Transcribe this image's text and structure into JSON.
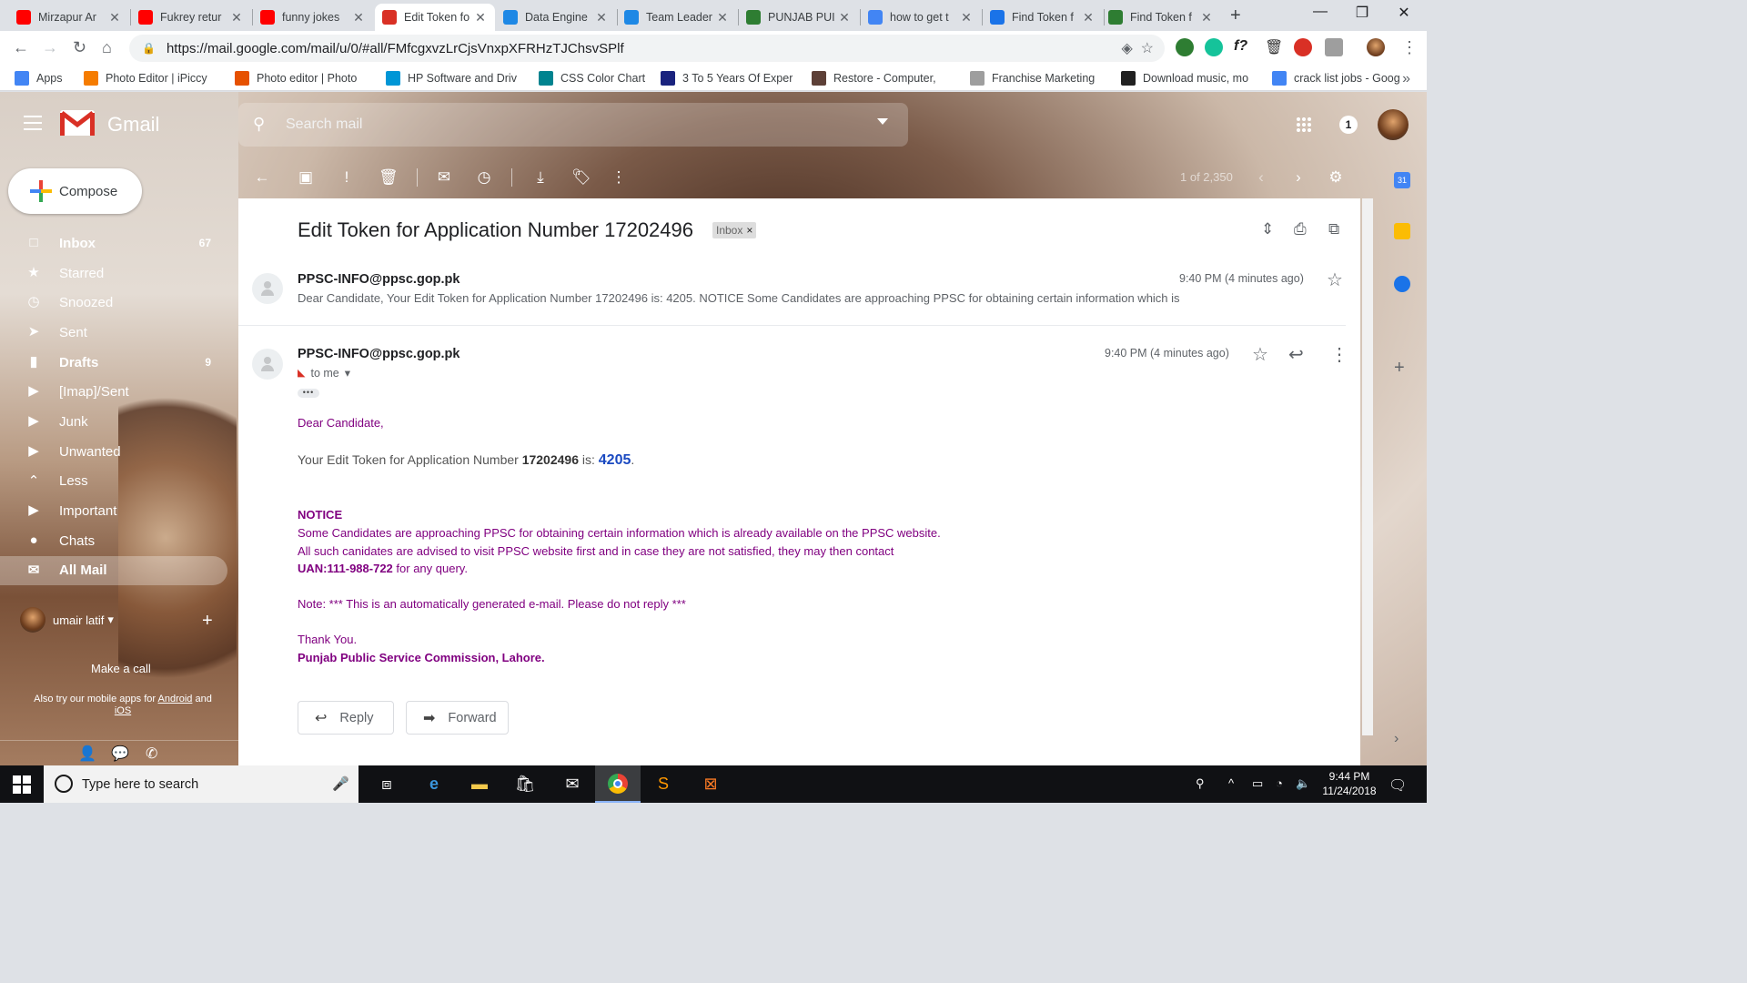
{
  "browser": {
    "tabs": [
      {
        "label": "Mirzapur Ar",
        "icon": "youtube-icon",
        "color": "#ff0000"
      },
      {
        "label": "Fukrey retur",
        "icon": "youtube-icon",
        "color": "#ff0000"
      },
      {
        "label": "funny jokes",
        "icon": "youtube-icon",
        "color": "#ff0000"
      },
      {
        "label": "Edit Token fo",
        "icon": "gmail-icon",
        "color": "#d93025",
        "active": true
      },
      {
        "label": "Data Engine",
        "icon": "b-icon",
        "color": "#1e88e5"
      },
      {
        "label": "Team Leader",
        "icon": "b-icon",
        "color": "#1e88e5"
      },
      {
        "label": "PUNJAB PUI",
        "icon": "ppsc-icon",
        "color": "#2e7d32"
      },
      {
        "label": "how to get t",
        "icon": "google-icon",
        "color": "#4285f4"
      },
      {
        "label": "Find Token f",
        "icon": "dot-icon",
        "color": "#1a73e8"
      },
      {
        "label": "Find Token f",
        "icon": "ppsc-icon",
        "color": "#2e7d32"
      }
    ],
    "new_tab": "+",
    "url": "https://mail.google.com/mail/u/0/#all/FMfcgxvzLrCjsVnxpXFRHzTJChsvSPlf",
    "bookmarks": [
      {
        "label": "Apps",
        "color": "#4285f4"
      },
      {
        "label": "Photo Editor | iPiccy",
        "color": "#f57c00"
      },
      {
        "label": "Photo editor | Photo",
        "color": "#e65100"
      },
      {
        "label": "HP Software and Driv",
        "color": "#0096d6"
      },
      {
        "label": "CSS Color Chart",
        "color": "#00838f"
      },
      {
        "label": "3 To 5 Years Of Exper",
        "color": "#1a237e"
      },
      {
        "label": "Restore - Computer, ",
        "color": "#5d4037"
      },
      {
        "label": "Franchise Marketing",
        "color": "#9e9e9e"
      },
      {
        "label": "Download music, mo",
        "color": "#212121"
      },
      {
        "label": "crack list jobs - Goog",
        "color": "#4285f4"
      }
    ],
    "bookmarks_more": "»"
  },
  "gmail": {
    "title": "Gmail",
    "search_placeholder": "Search mail",
    "notifications": "1",
    "compose_label": "Compose",
    "nav": [
      {
        "label": "Inbox",
        "count": "67",
        "icon": "□",
        "bold": true
      },
      {
        "label": "Starred",
        "count": "",
        "icon": "★"
      },
      {
        "label": "Snoozed",
        "count": "",
        "icon": "◷"
      },
      {
        "label": "Sent",
        "count": "",
        "icon": "➤"
      },
      {
        "label": "Drafts",
        "count": "9",
        "icon": "▮",
        "bold": true
      },
      {
        "label": "[Imap]/Sent",
        "count": "",
        "icon": "▶"
      },
      {
        "label": "Junk",
        "count": "",
        "icon": "▶"
      },
      {
        "label": "Unwanted",
        "count": "",
        "icon": "▶"
      },
      {
        "label": "Less",
        "count": "",
        "icon": "⌃"
      },
      {
        "label": "Important",
        "count": "",
        "icon": "▶"
      },
      {
        "label": "Chats",
        "count": "",
        "icon": "●"
      },
      {
        "label": "All Mail",
        "count": "",
        "icon": "✉",
        "selected": true
      }
    ],
    "hangouts_user": "umair latif",
    "make_call": "Make a call",
    "also_try": "Also try our mobile apps for",
    "android": "Android",
    "and": "and",
    "ios": "iOS",
    "message_count": "1 of 2,350"
  },
  "thread": {
    "subject": "Edit Token for Application Number 17202496",
    "label": "Inbox",
    "messages": [
      {
        "sender": "PPSC-INFO@ppsc.gop.pk",
        "time": "9:40 PM (4 minutes ago)",
        "snippet": "Dear Candidate, Your Edit Token for Application Number 17202496 is: 4205. NOTICE Some Candidates are approaching PPSC for obtaining certain information which is"
      },
      {
        "sender": "PPSC-INFO@ppsc.gop.pk",
        "time": "9:40 PM (4 minutes ago)",
        "to": "to me"
      }
    ],
    "body": {
      "greeting": "Dear Candidate,",
      "token_prefix": "Your Edit Token for Application Number ",
      "app_number": "17202496",
      "token_mid": " is: ",
      "token": "4205",
      "token_suffix": ".",
      "notice_title": "NOTICE",
      "notice_1": "Some Candidates are approaching PPSC for obtaining certain information which is already available on the PPSC website.",
      "notice_2": "All such canidates are advised to visit PPSC website first and in case they are not satisfied, they may then contact",
      "uan": "UAN:111-988-722",
      "uan_suffix": " for any query.",
      "note": "Note: *** This is an automatically generated e-mail. Please do not reply ***",
      "thanks": "Thank You.",
      "org": "Punjab Public Service Commission, Lahore."
    },
    "reply_label": "Reply",
    "forward_label": "Forward"
  },
  "taskbar": {
    "search_placeholder": "Type here to search",
    "time": "9:44 PM",
    "date": "11/24/2018"
  }
}
